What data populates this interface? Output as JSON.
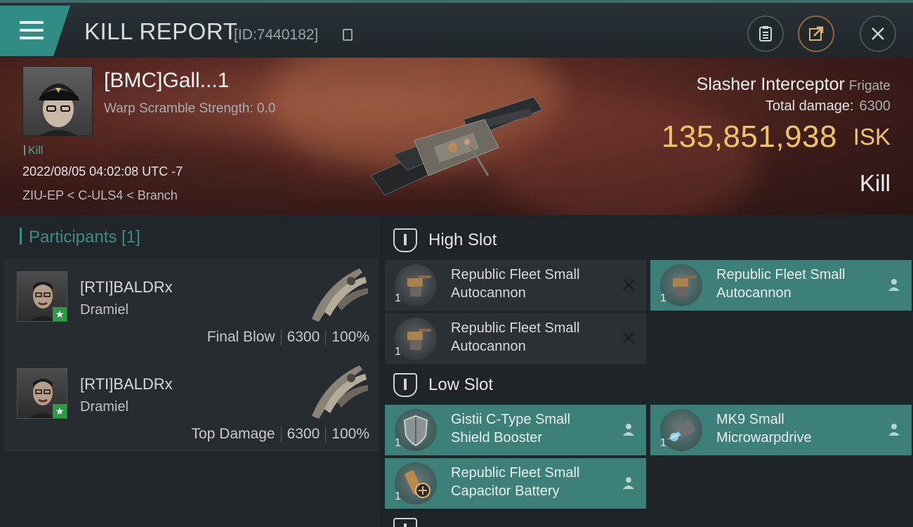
{
  "header": {
    "title": "KILL REPORT",
    "report_id": "[ID:7440182]",
    "buttons": [
      "clipboard-icon",
      "share-icon",
      "close-icon"
    ]
  },
  "victim": {
    "name": "[BMC]Gall...1",
    "scramble": "Warp Scramble Strength: 0.0",
    "tag": "Kill",
    "datetime": "2022/08/05 04:02:08 UTC -7",
    "location": "ZIU-EP < C-ULS4 < Branch",
    "ship": "Slasher Interceptor",
    "ship_class": "Frigate",
    "total_damage_label": "Total damage:",
    "total_damage": "6300",
    "isk_value": "135,851,938",
    "isk_unit": "ISK",
    "kill_type": "Kill"
  },
  "participants": {
    "header": "Participants [1]",
    "items": [
      {
        "name": "[RTI]BALDRx",
        "ship": "Dramiel",
        "role": "Final Blow",
        "damage": "6300",
        "percent": "100%"
      },
      {
        "name": "[RTI]BALDRx",
        "ship": "Dramiel",
        "role": "Top Damage",
        "damage": "6300",
        "percent": "100%"
      }
    ]
  },
  "slots": {
    "high": {
      "label": "High Slot",
      "modules": [
        {
          "name": "Republic Fleet Small Autocannon",
          "qty": "1",
          "status": "destroyed"
        },
        {
          "name": "Republic Fleet Small Autocannon",
          "qty": "1",
          "status": "dropped"
        },
        {
          "name": "Republic Fleet Small Autocannon",
          "qty": "1",
          "status": "destroyed"
        }
      ]
    },
    "low": {
      "label": "Low Slot",
      "modules": [
        {
          "name": "Gistii C-Type Small Shield Booster",
          "qty": "1",
          "status": "dropped"
        },
        {
          "name": "MK9 Small Microwarpdrive",
          "qty": "1",
          "status": "dropped"
        },
        {
          "name": "Republic Fleet Small Capacitor Battery",
          "qty": "1",
          "status": "dropped"
        }
      ]
    }
  },
  "colors": {
    "accent": "#3d7f79",
    "isk": "#f2c46a",
    "banner": "#5a2a23"
  }
}
